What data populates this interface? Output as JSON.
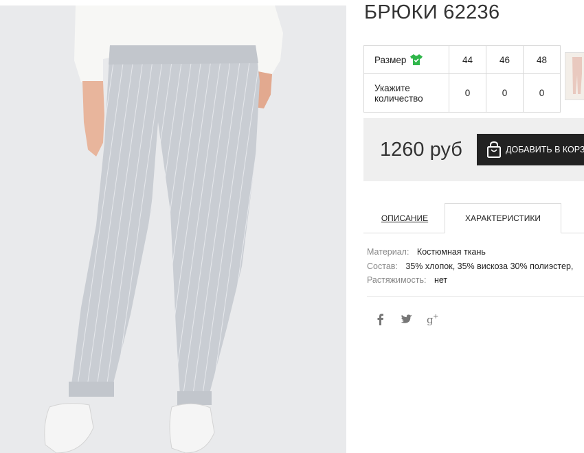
{
  "product": {
    "title": "БРЮКИ 62236",
    "price": "1260 руб",
    "add_to_cart_label": "ДОБАВИТЬ В КОРЗИНУ"
  },
  "size_table": {
    "size_label": "Размер",
    "quantity_label": "Укажите количество",
    "sizes": [
      "44",
      "46",
      "48"
    ],
    "quantities": [
      "0",
      "0",
      "0"
    ]
  },
  "tabs": [
    {
      "label": "ОПИСАНИЕ",
      "active": false
    },
    {
      "label": "ХАРАКТЕРИСТИКИ",
      "active": true
    }
  ],
  "specs": [
    {
      "key": "Материал:",
      "value": "Костюмная ткань"
    },
    {
      "key": "Состав:",
      "value": "35% хлопок, 35% вискоза 30% полиэстер,"
    },
    {
      "key": "Растяжимость:",
      "value": "нет"
    }
  ],
  "social": [
    "facebook-icon",
    "twitter-icon",
    "google-plus-icon"
  ],
  "colors": {
    "accent_green": "#2fb64a",
    "button_bg": "#222222",
    "buybox_bg": "#efefef"
  }
}
